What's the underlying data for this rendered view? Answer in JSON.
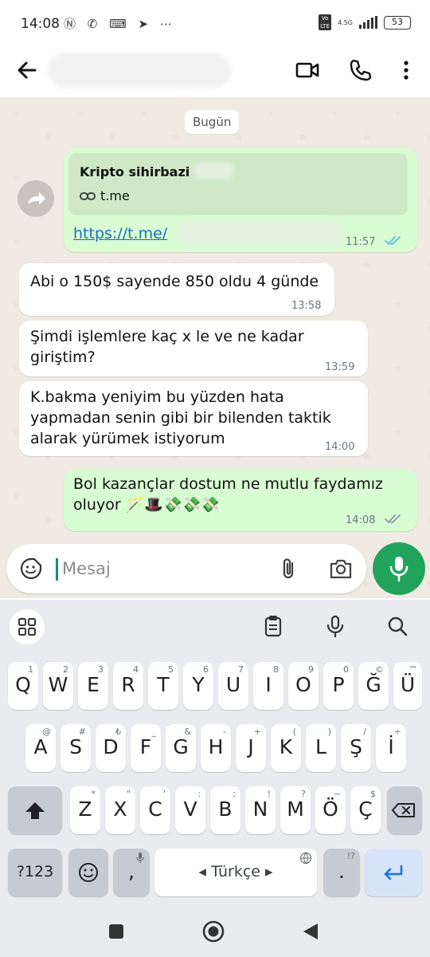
{
  "status_bar": {
    "time": "14:08",
    "network": "4.5G",
    "volte": "Vo LTE",
    "battery": "53"
  },
  "chat": {
    "date_chip": "Bugün",
    "forwarded": {
      "title": "Kripto sihirbazi",
      "link_label": "t.me",
      "url": "https://t.me/",
      "time": "11:57"
    },
    "messages": [
      {
        "text": "Abi o 150$ sayende 850 oldu 4 günde",
        "time": "13:58"
      },
      {
        "text": "Şimdi işlemlere kaç x le ve ne kadar giriştim?",
        "time": "13:59"
      },
      {
        "text": "K.bakma yeniyim bu yüzden hata yapmadan senin gibi bir bilenden taktik alarak yürümek istiyorum",
        "time": "14:00"
      },
      {
        "text": "Bol kazançlar dostum ne mutlu faydamız oluyor 🪄🎩💸💸💸",
        "time": "14:08"
      }
    ]
  },
  "composer": {
    "placeholder": "Mesaj"
  },
  "keyboard": {
    "row1": [
      {
        "key": "Q",
        "hint": "1"
      },
      {
        "key": "W",
        "hint": "2"
      },
      {
        "key": "E",
        "hint": "3"
      },
      {
        "key": "R",
        "hint": "4"
      },
      {
        "key": "T",
        "hint": "5"
      },
      {
        "key": "Y",
        "hint": "6"
      },
      {
        "key": "U",
        "hint": "7"
      },
      {
        "key": "I",
        "hint": "8"
      },
      {
        "key": "O",
        "hint": "9"
      },
      {
        "key": "P",
        "hint": "0"
      },
      {
        "key": "Ğ",
        "hint": "©"
      },
      {
        "key": "Ü",
        "hint": "™"
      }
    ],
    "row2": [
      {
        "key": "A",
        "hint": "@"
      },
      {
        "key": "S",
        "hint": "#"
      },
      {
        "key": "D",
        "hint": "₺"
      },
      {
        "key": "F",
        "hint": "_"
      },
      {
        "key": "G",
        "hint": "&"
      },
      {
        "key": "H",
        "hint": "-"
      },
      {
        "key": "J",
        "hint": "+"
      },
      {
        "key": "K",
        "hint": "("
      },
      {
        "key": "L",
        "hint": ")"
      },
      {
        "key": "Ş",
        "hint": "/"
      },
      {
        "key": "İ",
        "hint": "÷"
      }
    ],
    "row3": [
      {
        "key": "Z",
        "hint": "*"
      },
      {
        "key": "X",
        "hint": "\""
      },
      {
        "key": "C",
        "hint": "'"
      },
      {
        "key": "V",
        "hint": ":"
      },
      {
        "key": "B",
        "hint": ";"
      },
      {
        "key": "N",
        "hint": "!"
      },
      {
        "key": "M",
        "hint": "?"
      },
      {
        "key": "Ö",
        "hint": "~"
      },
      {
        "key": "Ç",
        "hint": "$"
      }
    ],
    "symbols_key": "?123",
    "comma_key": ",",
    "space_label": "Türkçe",
    "period_key": ".",
    "period_hint": "!?"
  }
}
